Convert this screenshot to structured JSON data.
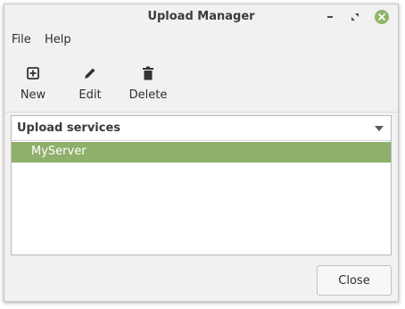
{
  "window": {
    "title": "Upload Manager",
    "accent_color": "#8fb069"
  },
  "menubar": {
    "items": [
      {
        "label": "File"
      },
      {
        "label": "Help"
      }
    ]
  },
  "toolbar": {
    "buttons": [
      {
        "label": "New",
        "icon": "add-square-icon"
      },
      {
        "label": "Edit",
        "icon": "pencil-icon"
      },
      {
        "label": "Delete",
        "icon": "trash-icon"
      }
    ]
  },
  "services_list": {
    "header": "Upload services",
    "rows": [
      {
        "label": "MyServer",
        "selected": true
      }
    ]
  },
  "footer": {
    "close_label": "Close"
  }
}
